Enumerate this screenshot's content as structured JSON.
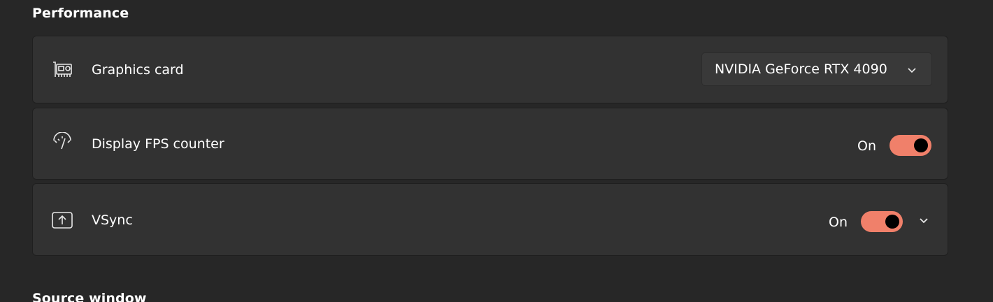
{
  "sections": {
    "performance_title": "Performance",
    "source_title": "Source window"
  },
  "rows": {
    "gpu": {
      "icon": "graphics-card-icon",
      "label": "Graphics card",
      "selected": "NVIDIA GeForce RTX 4090"
    },
    "fps": {
      "icon": "gauge-icon",
      "label": "Display FPS counter",
      "state_label": "On"
    },
    "vsync": {
      "icon": "vsync-icon",
      "label": "VSync",
      "state_label": "On"
    }
  },
  "colors": {
    "background": "#272727",
    "card": "#323232",
    "accent": "#f0806a",
    "text": "#ffffff"
  }
}
